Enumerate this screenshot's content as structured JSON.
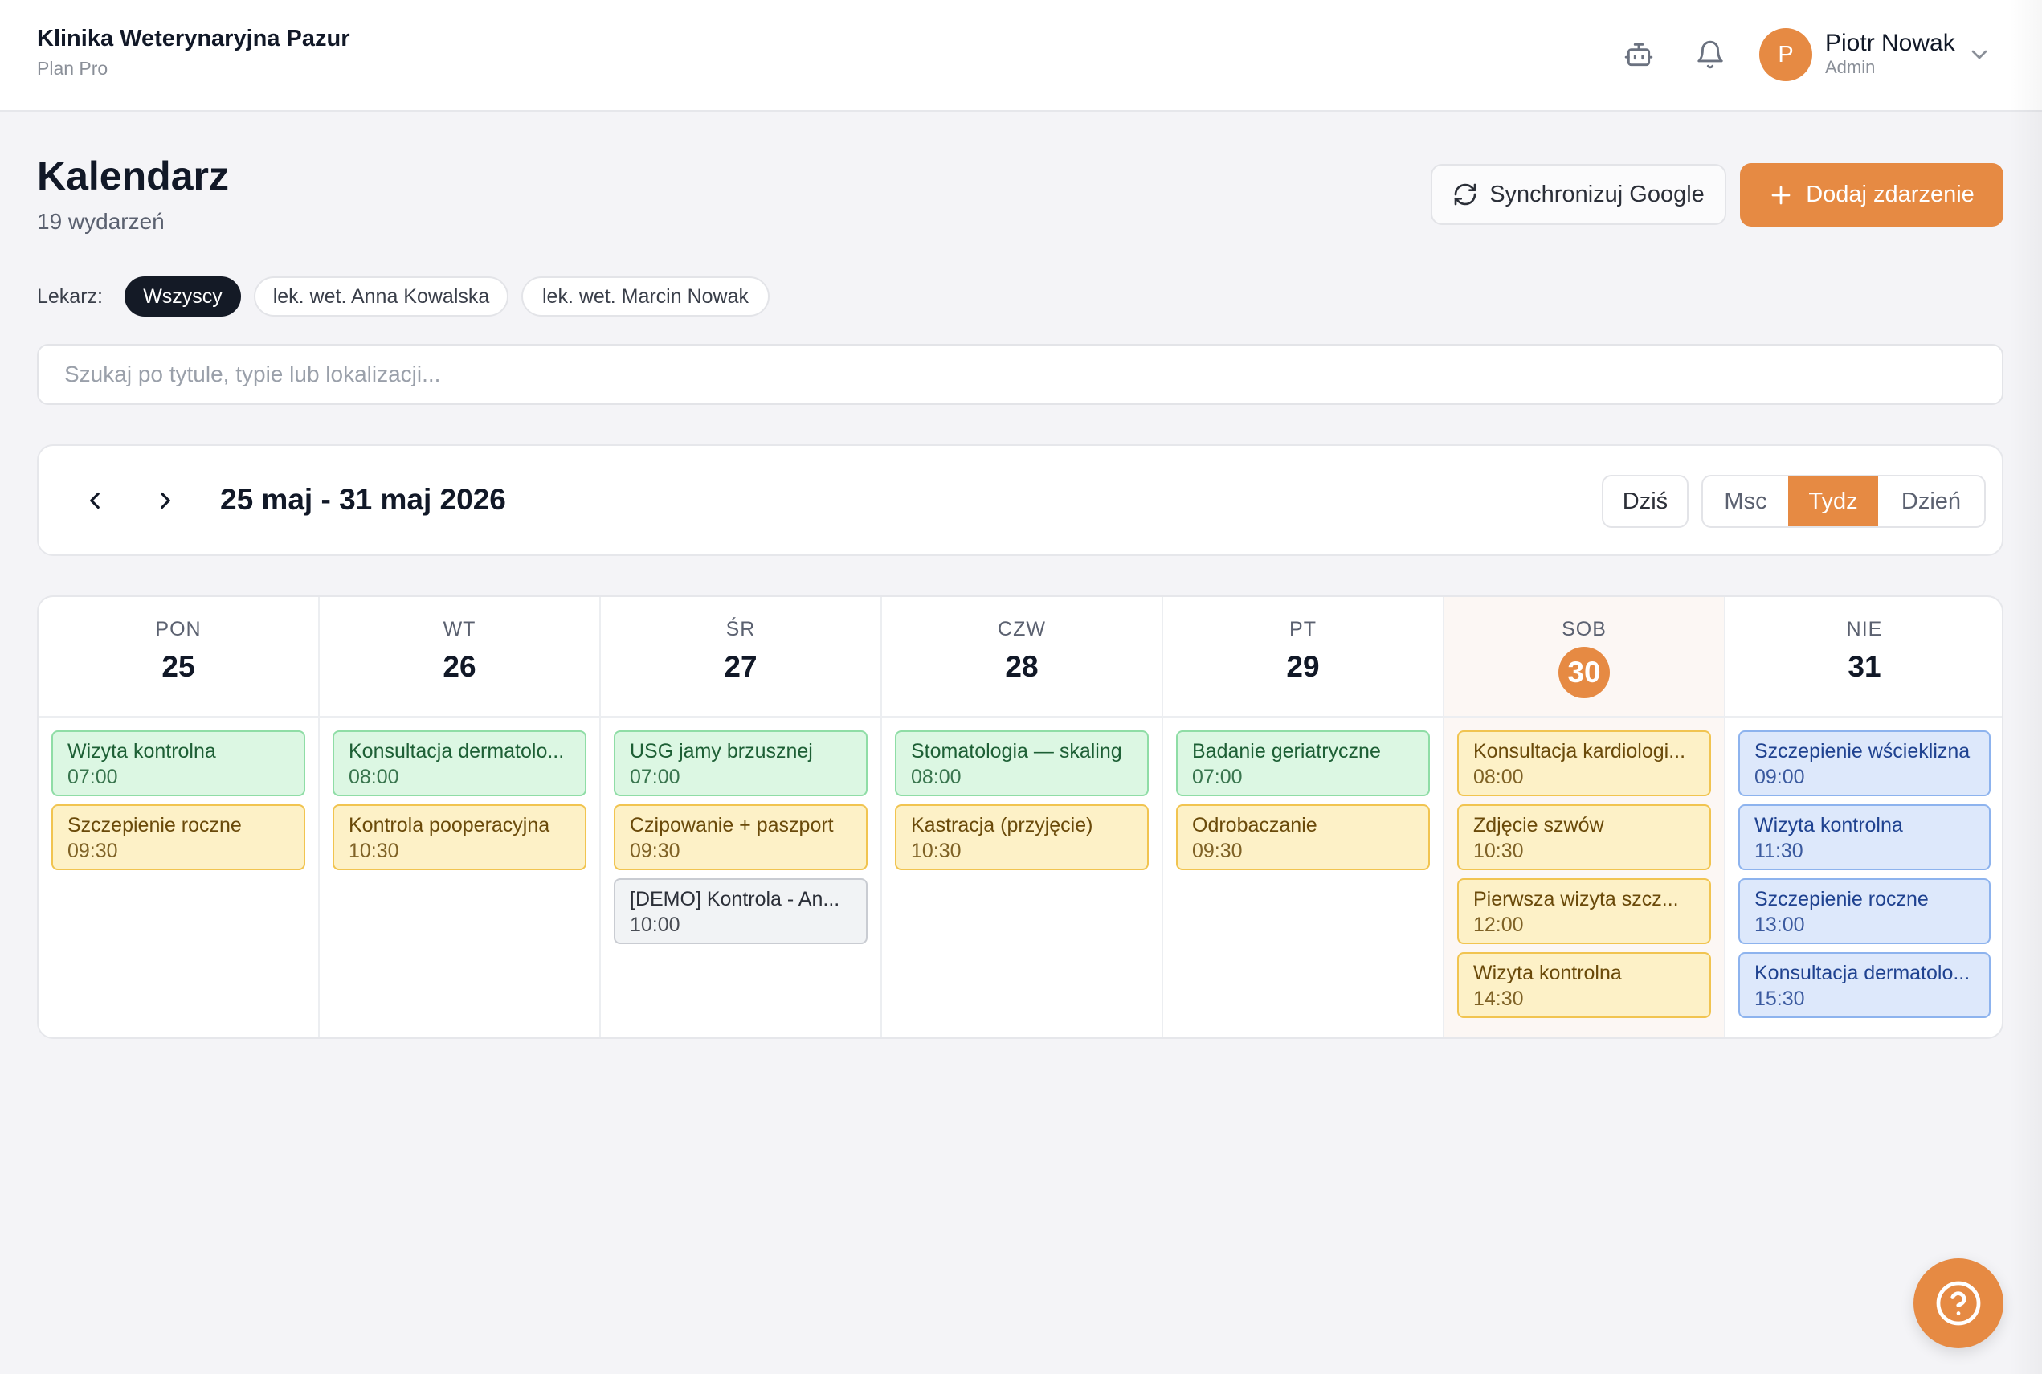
{
  "app": {
    "clinic_name": "Klinika Weterynaryjna Pazur",
    "plan": "Plan Pro"
  },
  "user": {
    "initial": "P",
    "name": "Piotr Nowak",
    "role": "Admin"
  },
  "icons": {
    "assistant": "robot-icon",
    "notifications": "bell-icon",
    "user_menu": "chevron-down-icon",
    "sync": "refresh-icon",
    "add": "plus-icon",
    "prev": "chevron-left-icon",
    "next": "chevron-right-icon",
    "help": "question-circle-icon"
  },
  "colors": {
    "accent": "#e68a43",
    "chip_active": "#141a26",
    "event_green": "#dcf7e3",
    "event_yellow": "#fdf1c7",
    "event_gray": "#f1f3f5",
    "event_blue": "#dde8fb"
  },
  "page": {
    "title": "Kalendarz",
    "count": "19 wydarzeń",
    "sync_button": "Synchronizuj Google",
    "add_button": "Dodaj zdarzenie"
  },
  "filters": {
    "label": "Lekarz:",
    "options": [
      {
        "label": "Wszyscy",
        "active": true
      },
      {
        "label": "lek. wet. Anna Kowalska",
        "active": false
      },
      {
        "label": "lek. wet. Marcin Nowak",
        "active": false
      }
    ]
  },
  "search": {
    "placeholder": "Szukaj po tytule, typie lub lokalizacji...",
    "value": ""
  },
  "calendar_nav": {
    "range": "25 maj - 31 maj 2026",
    "today": "Dziś",
    "views": [
      {
        "label": "Msc",
        "active": false
      },
      {
        "label": "Tydz",
        "active": true
      },
      {
        "label": "Dzień",
        "active": false
      }
    ]
  },
  "week": {
    "days": [
      {
        "dow": "PON",
        "num": "25",
        "today": false,
        "events": [
          {
            "title": "Wizyta kontrolna",
            "time": "07:00",
            "color": "green"
          },
          {
            "title": "Szczepienie roczne",
            "time": "09:30",
            "color": "yellow"
          }
        ]
      },
      {
        "dow": "WT",
        "num": "26",
        "today": false,
        "events": [
          {
            "title": "Konsultacja dermatolo...",
            "time": "08:00",
            "color": "green"
          },
          {
            "title": "Kontrola pooperacyjna",
            "time": "10:30",
            "color": "yellow"
          }
        ]
      },
      {
        "dow": "ŚR",
        "num": "27",
        "today": false,
        "events": [
          {
            "title": "USG jamy brzusznej",
            "time": "07:00",
            "color": "green"
          },
          {
            "title": "Czipowanie + paszport",
            "time": "09:30",
            "color": "yellow"
          },
          {
            "title": "[DEMO] Kontrola - An...",
            "time": "10:00",
            "color": "gray"
          }
        ]
      },
      {
        "dow": "CZW",
        "num": "28",
        "today": false,
        "events": [
          {
            "title": "Stomatologia — skaling",
            "time": "08:00",
            "color": "green"
          },
          {
            "title": "Kastracja (przyjęcie)",
            "time": "10:30",
            "color": "yellow"
          }
        ]
      },
      {
        "dow": "PT",
        "num": "29",
        "today": false,
        "events": [
          {
            "title": "Badanie geriatryczne",
            "time": "07:00",
            "color": "green"
          },
          {
            "title": "Odrobaczanie",
            "time": "09:30",
            "color": "yellow"
          }
        ]
      },
      {
        "dow": "SOB",
        "num": "30",
        "today": true,
        "events": [
          {
            "title": "Konsultacja kardiologi...",
            "time": "08:00",
            "color": "yellow"
          },
          {
            "title": "Zdjęcie szwów",
            "time": "10:30",
            "color": "yellow"
          },
          {
            "title": "Pierwsza wizyta szcz...",
            "time": "12:00",
            "color": "yellow"
          },
          {
            "title": "Wizyta kontrolna",
            "time": "14:30",
            "color": "yellow"
          }
        ]
      },
      {
        "dow": "NIE",
        "num": "31",
        "today": false,
        "events": [
          {
            "title": "Szczepienie wścieklizna",
            "time": "09:00",
            "color": "blue"
          },
          {
            "title": "Wizyta kontrolna",
            "time": "11:30",
            "color": "blue"
          },
          {
            "title": "Szczepienie roczne",
            "time": "13:00",
            "color": "blue"
          },
          {
            "title": "Konsultacja dermatolo...",
            "time": "15:30",
            "color": "blue"
          }
        ]
      }
    ]
  }
}
